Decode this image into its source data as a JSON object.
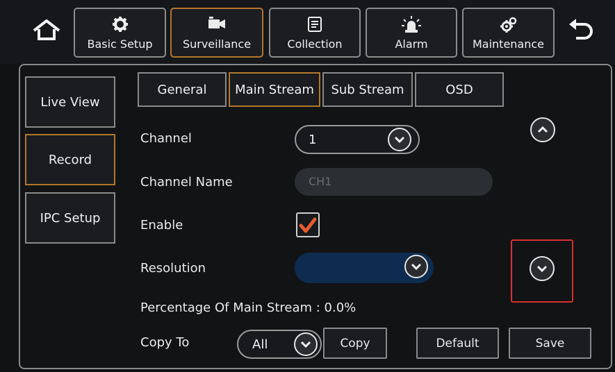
{
  "top_tabs": [
    {
      "label": "Basic Setup",
      "icon": "gear-icon"
    },
    {
      "label": "Surveillance",
      "icon": "camera-icon"
    },
    {
      "label": "Collection",
      "icon": "document-icon"
    },
    {
      "label": "Alarm",
      "icon": "alarm-light-icon"
    },
    {
      "label": "Maintenance",
      "icon": "gears-icon"
    }
  ],
  "sidebar": [
    {
      "label": "Live View"
    },
    {
      "label": "Record"
    },
    {
      "label": "IPC Setup"
    }
  ],
  "sub_tabs": [
    {
      "label": "General"
    },
    {
      "label": "Main Stream"
    },
    {
      "label": "Sub Stream"
    },
    {
      "label": "OSD"
    }
  ],
  "form": {
    "channel_label": "Channel",
    "channel_value": "1",
    "channel_name_label": "Channel Name",
    "channel_name_placeholder": "CH1",
    "enable_label": "Enable",
    "resolution_label": "Resolution",
    "percentage_text": "Percentage Of Main Stream : 0.0%",
    "copy_to_label": "Copy To",
    "copy_to_value": "All"
  },
  "buttons": {
    "copy": "Copy",
    "default": "Default",
    "save": "Save"
  },
  "colors": {
    "active_border": "#b2772a",
    "checkmark": "#e65c2e",
    "highlight_box": "#d8312f",
    "resolution_fill": "#0e2c4f"
  }
}
